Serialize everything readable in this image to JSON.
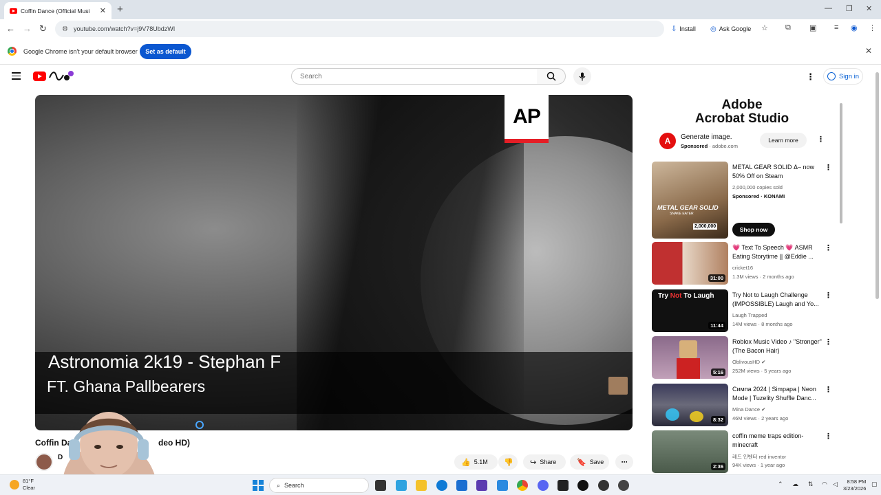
{
  "browser": {
    "tab_title": "Coffin Dance (Official Musi",
    "url": "youtube.com/watch?v=j9V78UbdzWI",
    "install_label": "Install",
    "ask_google_label": "Ask Google",
    "infobar_message": "Google Chrome isn't your default browser",
    "set_default_label": "Set as default"
  },
  "youtube": {
    "search_placeholder": "Search",
    "sign_in_label": "Sign in"
  },
  "player": {
    "watermark": "AP",
    "lyric_line_1": "Astronomia 2k19 - Stephan F",
    "lyric_line_2": "FT. Ghana Pallbearers"
  },
  "video": {
    "title_start": "Coffin Da",
    "title_end": "deo HD)",
    "channel_initial": "D",
    "like_count": "5.1M",
    "share_label": "Share",
    "save_label": "Save"
  },
  "ad": {
    "brand_line_1": "Adobe",
    "brand_line_2": "Acrobat Studio",
    "logo_letter": "A",
    "headline": "Generate image.",
    "sponsored": "Sponsored",
    "domain": "· adobe.com",
    "cta": "Learn more"
  },
  "sidebar": {
    "shop_now_label": "Shop now",
    "videos": [
      {
        "title": "METAL GEAR SOLID Δ– now 50% Off on Steam",
        "channel": "2,000,000 copies sold",
        "meta": "Sponsored · KONAMI",
        "duration": ""
      },
      {
        "title": "💗 Text To Speech 💗 ASMR Eating Storytime || @Eddie ...",
        "channel": "cricket16",
        "meta": "1.3M views · 2 months ago",
        "duration": "31:00"
      },
      {
        "title": "Try Not to Laugh Challenge (IMPOSSIBLE) Laugh and Yo...",
        "channel": "Laugh Trapped",
        "meta": "14M views · 8 months ago",
        "duration": "11:44"
      },
      {
        "title": "Roblox Music Video ♪ \"Stronger\" (The Bacon Hair)",
        "channel": "OblivousHD ✔",
        "meta": "252M views · 5 years ago",
        "duration": "5:16"
      },
      {
        "title": "Симпа 2024 | Simpapa | Neon Mode | Tuzelity Shuffle Danc...",
        "channel": "Mina Dance ✔",
        "meta": "46M views · 2 years ago",
        "duration": "8:32"
      },
      {
        "title": "coffin meme traps edition-minecraft",
        "channel": "레드 인벤터 red inventor",
        "meta": "94K views · 1 year ago",
        "duration": "2:36"
      }
    ],
    "thumb_text": {
      "mgs_title": "METAL GEAR SOLID",
      "mgs_sub": "SNAKE EATER",
      "mgs_badge": "2,000,000",
      "laugh_a": "Try ",
      "laugh_b": "Not ",
      "laugh_c": "To Laugh"
    }
  },
  "taskbar": {
    "temperature": "81°F",
    "weather": "Clear",
    "search_label": "Search",
    "time": "8:58 PM",
    "date": "3/23/2026"
  },
  "colors": {
    "youtube_red": "#ff0000",
    "chrome_blue": "#0b57d0",
    "link_blue": "#065fd4",
    "ap_red": "#e41e26"
  }
}
